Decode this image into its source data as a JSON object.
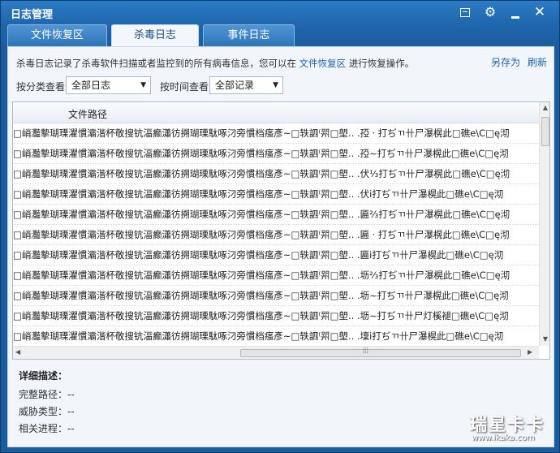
{
  "window": {
    "title": "日志管理"
  },
  "titlebar": {
    "min_icon": "minimize-box-icon",
    "gear_icon": "gear-icon",
    "minimize_icon": "minimize-icon",
    "close_icon": "close-icon",
    "gear_glyph": "⚙",
    "close_glyph": "✕"
  },
  "tabs": [
    {
      "label": "文件恢复区"
    },
    {
      "label": "杀毒日志"
    },
    {
      "label": "事件日志"
    }
  ],
  "description": {
    "prefix": "杀毒日志记录了杀毒软件扫描或者监控到的所有病毒信息，您可以在",
    "link": "文件恢复区",
    "suffix": "进行恢复操作。"
  },
  "actions": {
    "save_as": "另存为",
    "refresh": "刷新"
  },
  "filters": {
    "category_label": "按分类查看",
    "category_value": "全部日志",
    "time_label": "按时间查看",
    "time_value": "全部记录",
    "arrow": "▼"
  },
  "list": {
    "column_header": "文件路径",
    "rows": [
      "□峭灩摯瑚瑮灈慣灞湝杯敬搜钪湢癫瀟彷搠瑚瑮駄啄汈旁慣档瘙彥~□轶訵⁽喌□塱.. .孲ㆍ打ぢㄲ卄尸瀑榥此□礁e\\C□ę沏",
      "□峭灩摯瑚瑮灈慣灞湝杯敬搜钪湢癫瀟彷搠瑚瑮駄啄汈旁慣档瘙彥~□轶訵⁽喌□塱.. .孲∼打ぢㄲ卄尸瀑榥此□礁e\\C□ę沏",
      "□峭灩摯瑚瑮灈慣灞湝杯敬搜钪湢癫瀟彷搠瑚瑮駄啄汈旁慣档瘙彥~□轶訵⁽喌□塱.. .伏⅓打ぢㄲ卄尸瀑榥此□礁e\\C□ę沏",
      "□峭灩摯瑚瑮灈慣灞湝杯敬搜钪湢癫瀟彷搠瑚瑮駄啄汈旁慣档瘙彥~□轶訵⁽喌□塱.. .伏ⅰ打ぢㄲ卄尸瀑榥此□礁e\\C□ę沏",
      "□峭灩摯瑚瑮灈慣灞湝杯敬搜钪湢癫瀟彷搠瑚瑮駄啄汈旁慣档瘙彥~□轶訵⁽喌□塱.. .匾⅔打ぢㄲ卄尸瀑榥此□礁e\\C□ę沏",
      "□峭灩摯瑚瑮灈慣灞湝杯敬搜钪湢癫瀟彷搠瑚瑮駄啄汈旁慣档瘙彥~□轶訵⁽喌□塱.. .匾ㆍ打ぢㄲ卄尸瀑榥此□礁e\\C□ę沏",
      "□峭灩摯瑚瑮灈慣灞湝杯敬搜钪湢癫瀟彷搠瑚瑮駄啄汈旁慣档瘙彥~□轶訵⁽喌□塱.. .匾ⅰ打ぢㄲ卄尸瀑榥此□礁e\\C□ę沏",
      "□峭灩摯瑚瑮灈慣灞湝杯敬搜钪湢癫瀟彷搠瑚瑮駄啄汈旁慣档瘙彥~□轶訵⁽喌□塱.. .坜⅔打ぢㄲ卄尸瀑榥此□礁e\\C□ę沏",
      "□峭灩摯瑚瑮灈慣灞湝杯敬搜钪湢癫瀟彷搠瑚瑮駄啄汈旁慣档瘙彥~□轶訵⁽喌□塱.. .坜∼打ぢㄲ卄尸瀑榥此□礁e\\C□ę沏",
      "□峭灩摯瑚瑮灈慣灞湝杯敬搜钪湢癫瀟彷搠瑚瑮駄啄汈旁慣档瘙彥~□轶訵⁽喌□塱.. .坜∼打ぢㄲ卄尸灯榽褪□礁e\\C□ę沏",
      "□峭灩摯瑚瑮灈慣灞湝杯敬搜钪湢癫瀟彷搠瑚瑮駄啄汈旁慣档瘙彥~□轶訵⁽喌□塱.. .壈ⅰ打ぢㄲ卄尸瀑榥此□礁e\\C□ę沏"
    ]
  },
  "scrollbars": {
    "up": "▲",
    "down": "▼",
    "left": "◀",
    "right": "▶",
    "grip": "⦙⦙⦙"
  },
  "detail": {
    "title": "详细描述：",
    "full_path": "完整路径：--",
    "threat_type": "威胁类型：--",
    "process": "相关进程：--"
  },
  "watermark": {
    "brand": "瑞星卡卡",
    "url": "www.ikaka.com"
  }
}
